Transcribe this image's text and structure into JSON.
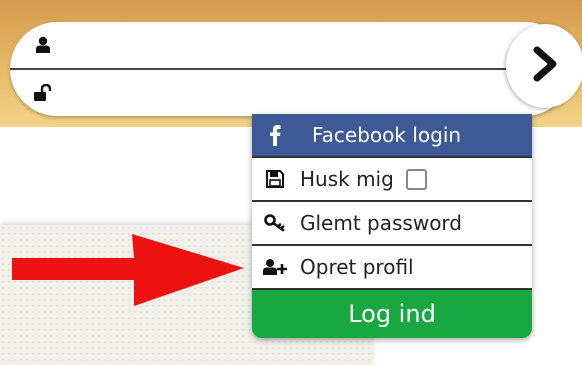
{
  "login_form": {
    "username_icon": "user-icon",
    "password_icon": "unlock-icon",
    "submit_icon": "chevron-right-icon"
  },
  "menu": {
    "facebook_login": "Facebook login",
    "remember_me": "Husk mig",
    "forgot_password": "Glemt password",
    "create_profile": "Opret profil",
    "login_button": "Log ind"
  },
  "colors": {
    "header_band": "#e3ad5e",
    "facebook_blue": "#3d5996",
    "login_green": "#18a842",
    "arrow_red": "#ee1111"
  }
}
